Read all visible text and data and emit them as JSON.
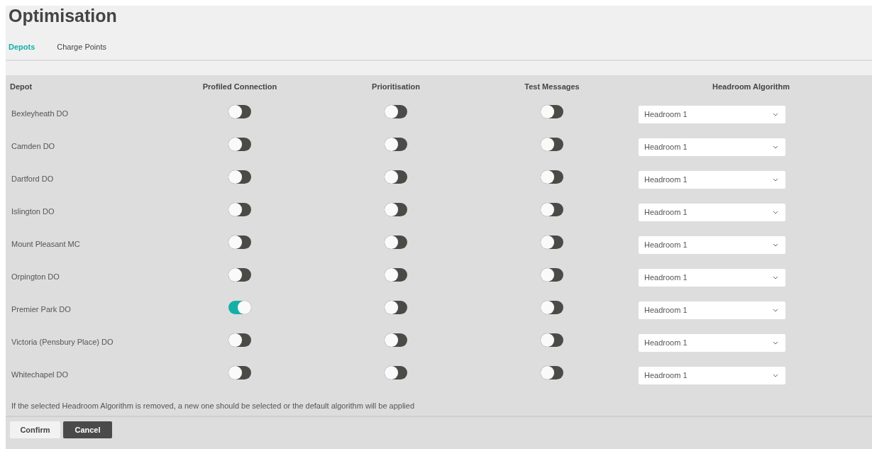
{
  "title": "Optimisation",
  "tabs": [
    {
      "label": "Depots",
      "selected": true
    },
    {
      "label": "Charge Points",
      "selected": false
    }
  ],
  "table": {
    "columns": [
      "Depot",
      "Profiled Connection",
      "Prioritisation",
      "Test Messages",
      "Headroom Algorithm"
    ],
    "rows": [
      {
        "depot": "Bexleyheath DO",
        "profiled": false,
        "prioritisation": false,
        "test_messages": false,
        "headroom": "Headroom 1"
      },
      {
        "depot": "Camden DO",
        "profiled": false,
        "prioritisation": false,
        "test_messages": false,
        "headroom": "Headroom 1"
      },
      {
        "depot": "Dartford DO",
        "profiled": false,
        "prioritisation": false,
        "test_messages": false,
        "headroom": "Headroom 1"
      },
      {
        "depot": "Islington DO",
        "profiled": false,
        "prioritisation": false,
        "test_messages": false,
        "headroom": "Headroom 1"
      },
      {
        "depot": "Mount Pleasant MC",
        "profiled": false,
        "prioritisation": false,
        "test_messages": false,
        "headroom": "Headroom 1"
      },
      {
        "depot": "Orpington DO",
        "profiled": false,
        "prioritisation": false,
        "test_messages": false,
        "headroom": "Headroom 1"
      },
      {
        "depot": "Premier Park DO",
        "profiled": true,
        "prioritisation": false,
        "test_messages": false,
        "headroom": "Headroom 1"
      },
      {
        "depot": "Victoria (Pensbury Place) DO",
        "profiled": false,
        "prioritisation": false,
        "test_messages": false,
        "headroom": "Headroom 1"
      },
      {
        "depot": "Whitechapel DO",
        "profiled": false,
        "prioritisation": false,
        "test_messages": false,
        "headroom": "Headroom 1"
      }
    ]
  },
  "note": "If the selected Headroom Algorithm is removed, a new one should be selected or the default algorithm will be applied",
  "buttons": [
    {
      "label": "Confirm",
      "kind": "secondary"
    },
    {
      "label": "Cancel",
      "kind": "primary"
    }
  ]
}
